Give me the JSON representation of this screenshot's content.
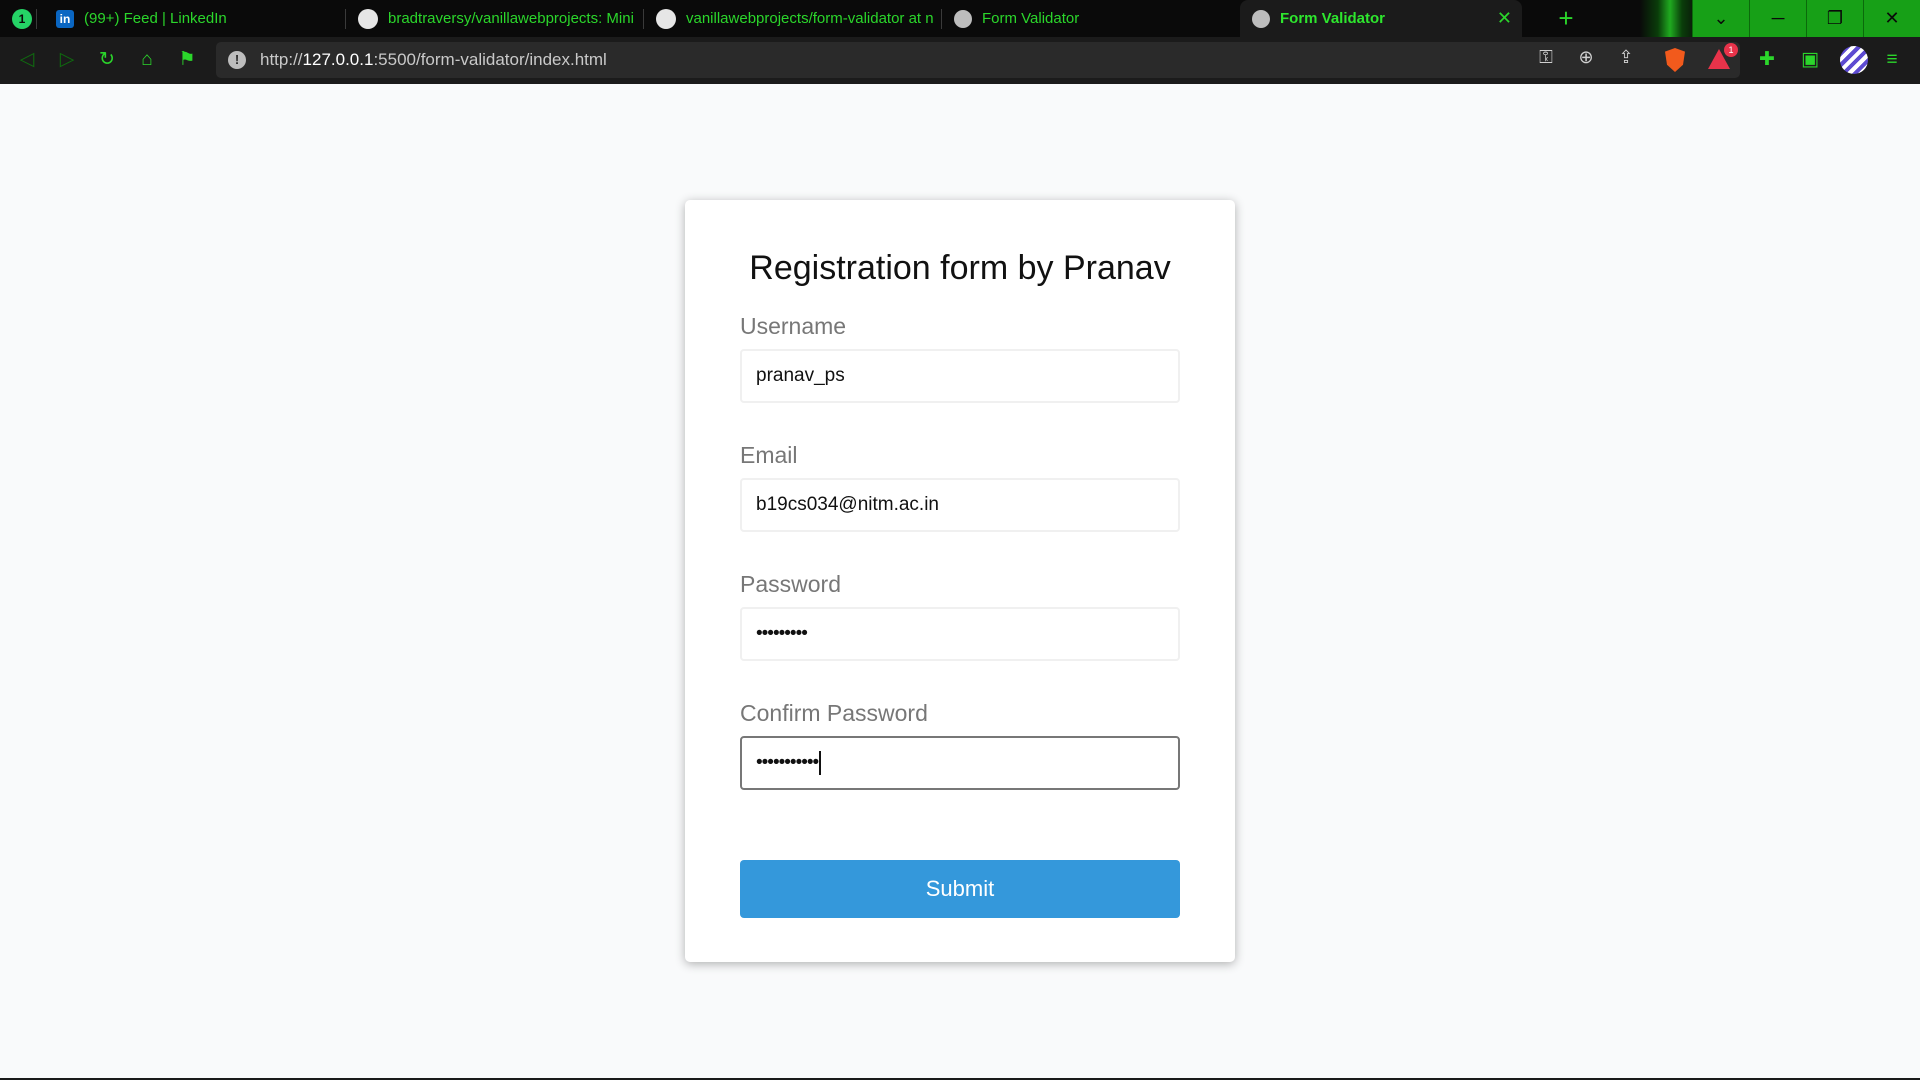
{
  "browser": {
    "tabs": [
      {
        "title": "",
        "icon": "whatsapp-icon",
        "badge": "1"
      },
      {
        "title": "(99+) Feed | LinkedIn",
        "icon": "linkedin-icon"
      },
      {
        "title": "bradtraversy/vanillawebprojects: Mini",
        "icon": "github-icon"
      },
      {
        "title": "vanillawebprojects/form-validator at n",
        "icon": "github-icon"
      },
      {
        "title": "Form Validator",
        "icon": "globe-icon"
      },
      {
        "title": "Form Validator",
        "icon": "globe-icon",
        "active": true
      }
    ],
    "url_prefix": "http://",
    "url_host": "127.0.0.1",
    "url_rest": ":5500/form-validator/index.html",
    "rewards_badge": "1",
    "accent_color": "#2bd62b"
  },
  "form": {
    "title": "Registration form by Pranav",
    "fields": [
      {
        "label": "Username",
        "value": "pranav_ps",
        "type": "text"
      },
      {
        "label": "Email",
        "value": "b19cs034@nitm.ac.in",
        "type": "email"
      },
      {
        "label": "Password",
        "value": "•••••••••",
        "type": "password"
      },
      {
        "label": "Confirm Password",
        "value": "•••••••••••",
        "type": "password",
        "focused": true
      }
    ],
    "submit_label": "Submit",
    "submit_color": "#3498db"
  }
}
